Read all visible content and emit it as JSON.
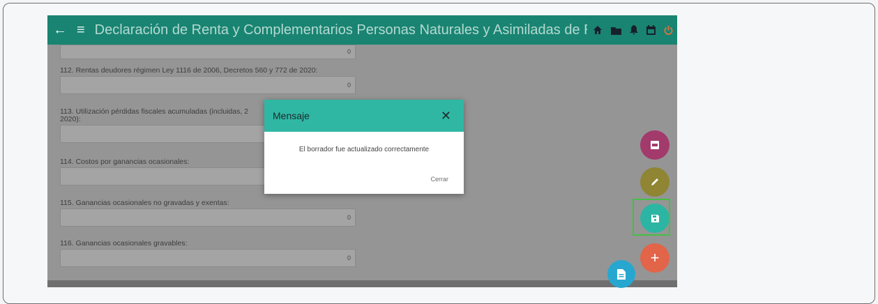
{
  "app": {
    "title": "Declaración de Renta y Complementarios Personas Naturales y Asimiladas de Resid"
  },
  "topbar_icons": [
    "home-icon",
    "folder-icon",
    "bell-icon",
    "calendar-icon",
    "power-icon"
  ],
  "form": {
    "fields": [
      {
        "label": "",
        "value": "0"
      },
      {
        "label": "112. Rentas deudores régimen Ley 1116 de 2006, Decretos 560 y 772 de 2020:",
        "value": "0"
      },
      {
        "label_line1": "113. Utilización pérdidas fiscales acumuladas (incluidas, 2",
        "label_line2": "2020):",
        "value": ""
      },
      {
        "label": "114. Costos por ganancias ocasionales:",
        "value": ""
      },
      {
        "label": "115. Ganancias ocasionales no gravadas y exentas:",
        "value": "0"
      },
      {
        "label": "116. Ganancias ocasionales gravables:",
        "value": "0"
      }
    ]
  },
  "modal": {
    "title": "Mensaje",
    "close_glyph": "✕",
    "message": "El borrador fue actualizado correctamente",
    "button": "Cerrar"
  },
  "fabs": {
    "plus_glyph": "+"
  },
  "colors": {
    "topbar": "#198472",
    "modal_header": "#2fb7a4",
    "fab_pdf": "#a33a6c",
    "fab_edit": "#8f8533",
    "fab_save": "#2db5a4",
    "fab_add": "#e26449",
    "fab_doc": "#27a7cf",
    "highlight": "#44c044"
  }
}
